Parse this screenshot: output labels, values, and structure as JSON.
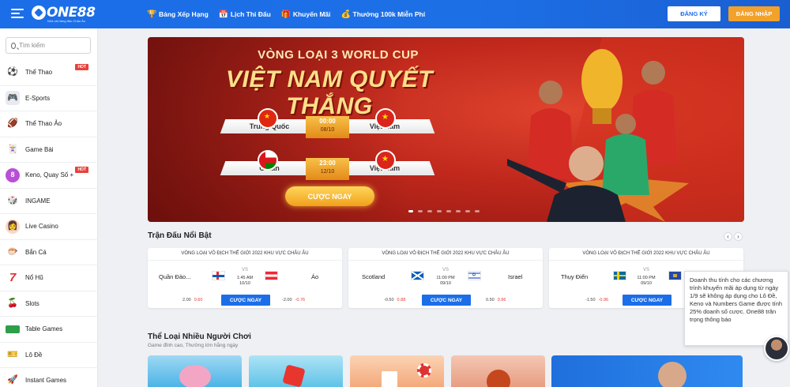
{
  "header": {
    "logo_text": "ONE88",
    "logo_sub": "Nhà cái hàng đầu Châu Âu",
    "nav": [
      {
        "label": "Bảng Xếp Hạng",
        "icon": "trophy-icon"
      },
      {
        "label": "Lịch Thi Đấu",
        "icon": "calendar-icon"
      },
      {
        "label": "Khuyến Mãi",
        "icon": "gift-icon"
      },
      {
        "label": "Thưởng 100k Miễn Phí",
        "icon": "coin-icon"
      }
    ],
    "register_label": "ĐĂNG KÝ",
    "login_label": "ĐĂNG NHẬP"
  },
  "sidebar": {
    "search_placeholder": "Tìm kiếm",
    "items": [
      {
        "label": "Thể Thao",
        "icon": "soccer-ball-icon",
        "hot": "HOT"
      },
      {
        "label": "E-Sports",
        "icon": "gamepad-icon"
      },
      {
        "label": "Thể Thao Ảo",
        "icon": "football-icon"
      },
      {
        "label": "Game Bài",
        "icon": "cards-icon"
      },
      {
        "label": "Keno, Quay Số +",
        "icon": "lottery-ball-icon",
        "hot": "HOT"
      },
      {
        "label": "INGAME",
        "icon": "dice-icon"
      },
      {
        "label": "Live Casino",
        "icon": "dealer-icon"
      },
      {
        "label": "Bắn Cá",
        "icon": "fish-icon"
      },
      {
        "label": "Nổ Hũ",
        "icon": "slot-seven-icon"
      },
      {
        "label": "Slots",
        "icon": "cherry-icon"
      },
      {
        "label": "Table Games",
        "icon": "table-icon"
      },
      {
        "label": "Lô Đề",
        "icon": "ticket-icon"
      },
      {
        "label": "Instant Games",
        "icon": "rocket-icon"
      }
    ]
  },
  "banner": {
    "subtitle": "VÒNG LOẠI 3 WORLD CUP",
    "title": "VIỆT NAM QUYẾT THẮNG",
    "matches": [
      {
        "home": "Trung Quốc",
        "away": "Việt Nam",
        "time": "00:00",
        "date": "08/10"
      },
      {
        "home": "Oman",
        "away": "Việt Nam",
        "time": "23:00",
        "date": "12/10"
      }
    ],
    "cta_label": "CƯỢC NGAY",
    "slides": 8,
    "active_slide": 1
  },
  "featured": {
    "title": "Trận Đấu Nổi Bật",
    "cards": [
      {
        "league": "VÒNG LOẠI VÔ ĐỊCH THẾ GIỚI 2022 KHU VỰC CHÂU ÂU",
        "home": "Quần Đảo...",
        "away": "Áo",
        "vs": "VS",
        "time": "1:45 AM",
        "date": "10/10",
        "odds_home": "2.00",
        "odds_home_neg": "0.60",
        "odds_away": "-2.00",
        "odds_away_neg": "-0.76",
        "bet_label": "CƯỢC NGAY"
      },
      {
        "league": "VÒNG LOẠI VÔ ĐỊCH THẾ GIỚI 2022 KHU VỰC CHÂU ÂU",
        "home": "Scotland",
        "away": "Israel",
        "vs": "VS",
        "time": "11:00 PM",
        "date": "09/10",
        "odds_home": "-0.50",
        "odds_home_neg": "0.88",
        "odds_away": "0.50",
        "odds_away_neg": "0.96",
        "bet_label": "CƯỢC NGAY"
      },
      {
        "league": "VÒNG LOẠI VÔ ĐỊCH THẾ GIỚI 2022 KHU VỰC CHÂU ÂU",
        "home": "Thụy Điển",
        "away": "",
        "vs": "VS",
        "time": "11:00 PM",
        "date": "09/10",
        "odds_home": "-1.50",
        "odds_home_neg": "-0.96",
        "odds_away": "",
        "odds_away_neg": "",
        "bet_label": "CƯỢC NGAY"
      }
    ]
  },
  "tooltip": "Doanh thu tính cho các chương trình khuyến mãi áp dụng từ ngày 1/9 sẽ không áp dụng cho Lô Đề, Keno và Numbers Game được tính 25% doanh số cược. One88 trân trọng thông báo",
  "popular": {
    "title": "Thể Loại Nhiều Người Chơi",
    "subtitle": "Game đỉnh cao, Thưởng lớn hằng ngày"
  }
}
